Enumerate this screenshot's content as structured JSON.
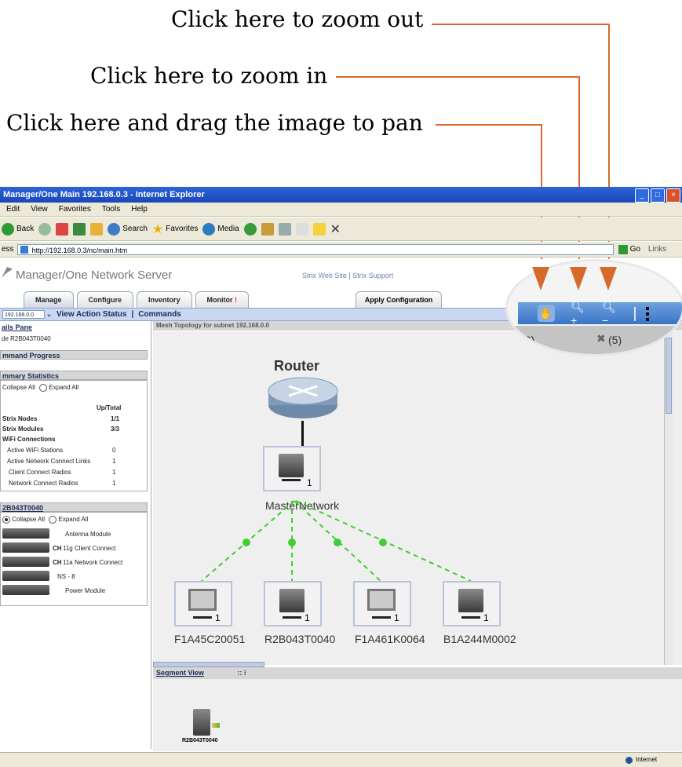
{
  "callouts": {
    "zoom_out": "Click here to zoom out",
    "zoom_in": "Click here to zoom in",
    "pan": "Click here and drag the image to pan"
  },
  "window": {
    "title": "Manager/One Main 192.168.0.3 - Internet Explorer"
  },
  "menu": [
    "Edit",
    "View",
    "Favorites",
    "Tools",
    "Help"
  ],
  "toolbar": {
    "back": "Back",
    "search": "Search",
    "favorites": "Favorites",
    "media": "Media"
  },
  "address": {
    "label": "ess",
    "url": "http://192.168.0.3/nc/main.htm",
    "go": "Go",
    "links": "Links"
  },
  "app": {
    "title": "Manager/One Network Server",
    "top_links": "Strix Web Site  |  Strix Support",
    "tabs": [
      "Manage",
      "Configure",
      "Inventory",
      "Monitor"
    ],
    "monitor_alert": "!",
    "apply_config": "Apply Configuration",
    "subnet_select": "192.168.0.0",
    "view_action_status": "View Action Status",
    "commands": "Commands",
    "separator": "|"
  },
  "left_pane": {
    "details_header": "ails Pane",
    "node_line": "de R2B043T0040",
    "command_progress": "mmand Progress",
    "summary_header": "mmary Statistics",
    "collapse_all": "Collapse All",
    "expand_all": "Expand All",
    "col_header": "Up/Total",
    "stats": [
      {
        "label": "Strix Nodes",
        "value": "1/1",
        "bold": true
      },
      {
        "label": "Strix Modules",
        "value": "3/3",
        "bold": true
      },
      {
        "label": "WiFi Connections",
        "value": "",
        "bold": true
      },
      {
        "label": "Active WiFi Stations",
        "value": "0",
        "bold": false
      },
      {
        "label": "Active Network Connect Links",
        "value": "1",
        "bold": false
      },
      {
        "label": "Client Connect Radios",
        "value": "1",
        "bold": false
      },
      {
        "label": "Network Connect Radios",
        "value": "1",
        "bold": false
      }
    ],
    "node_header": "2B043T0040",
    "modules": [
      {
        "label": "Antenna Module",
        "prefix": ""
      },
      {
        "label": "11g Client Connect",
        "prefix": "CH"
      },
      {
        "label": "11a Network Connect",
        "prefix": "CH"
      },
      {
        "label": "NS - 8",
        "prefix": ""
      },
      {
        "label": "Power Module",
        "prefix": ""
      }
    ]
  },
  "main": {
    "header": "Mesh Topology for subnet 192.168.0.0",
    "router_label": "Router",
    "master": {
      "label": "MasterNetwork",
      "count": "1"
    },
    "nodes": [
      {
        "label": "F1A45C20051",
        "type": "monitor",
        "count": "1"
      },
      {
        "label": "R2B043T0040",
        "type": "server",
        "count": "1"
      },
      {
        "label": "F1A461K0064",
        "type": "monitor",
        "count": "1"
      },
      {
        "label": "B1A244M0002",
        "type": "server",
        "count": "1"
      }
    ],
    "alarms": [
      {
        "count": "(0)",
        "color": "#d63030"
      },
      {
        "count": "(5)",
        "color": "#555555"
      }
    ]
  },
  "segment": {
    "header": "Segment View",
    "node_label": "R2B043T0040"
  },
  "status": {
    "zone": "Internet"
  },
  "colors": {
    "callout_line": "#d76a2b",
    "link_green": "#44cc33",
    "toolbar_blue": "#3a76c5"
  }
}
